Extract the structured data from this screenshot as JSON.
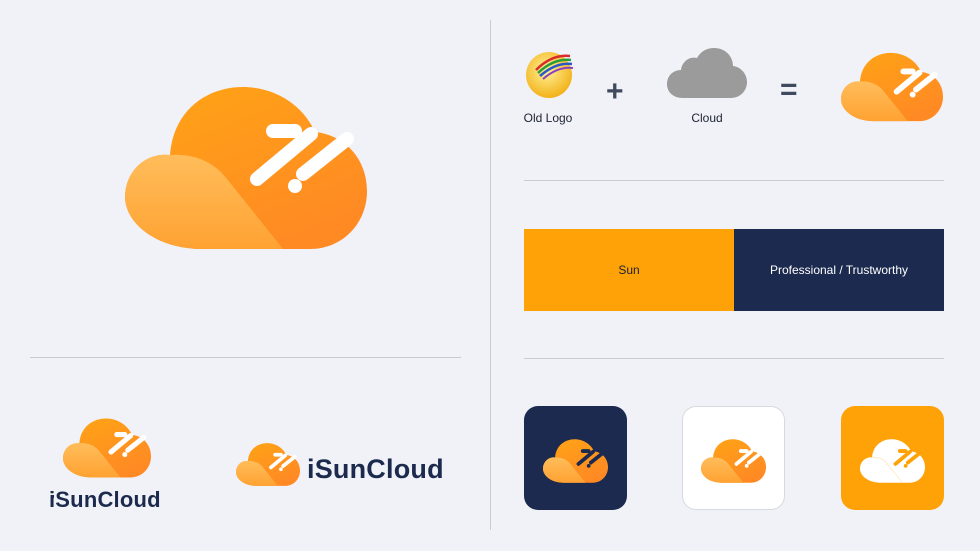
{
  "brand": {
    "name": "iSunCloud",
    "wordmark_rest": "SunCloud"
  },
  "equation": {
    "old_logo_label": "Old Logo",
    "cloud_label": "Cloud",
    "plus_symbol": "+",
    "equals_symbol": "="
  },
  "palette": {
    "sun": {
      "label": "Sun",
      "color": "#ffa208"
    },
    "navy": {
      "label": "Professional / Trustworthy",
      "color": "#1b2a4e"
    }
  },
  "app_icons": {
    "backgrounds": [
      "#1b2a4e",
      "#ffffff",
      "#ffa208"
    ]
  },
  "colors": {
    "cloud_top": "#ffa020",
    "cloud_bottom": "#ff8a1c",
    "cloud_light": "#ffb756",
    "grey_cloud": "#9a9a9a",
    "background": "#f1f2f8"
  }
}
